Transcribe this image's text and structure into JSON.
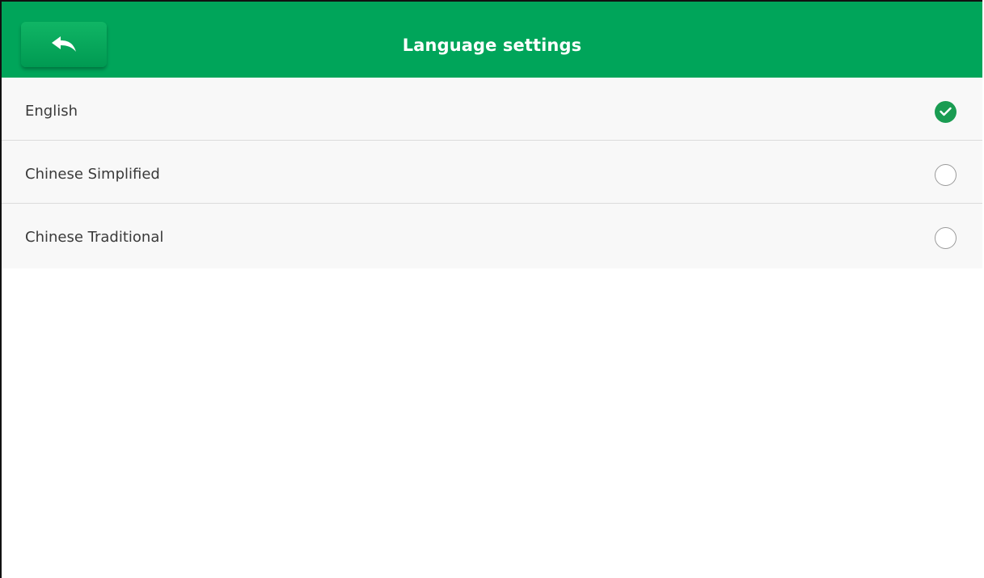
{
  "header": {
    "title": "Language settings",
    "back_icon": "reply-arrow-icon",
    "color": "#00a55a"
  },
  "languages": [
    {
      "label": "English",
      "selected": true
    },
    {
      "label": "Chinese Simplified",
      "selected": false
    },
    {
      "label": "Chinese Traditional",
      "selected": false
    }
  ],
  "colors": {
    "accent": "#00a55a",
    "check": "#1a9c52"
  }
}
